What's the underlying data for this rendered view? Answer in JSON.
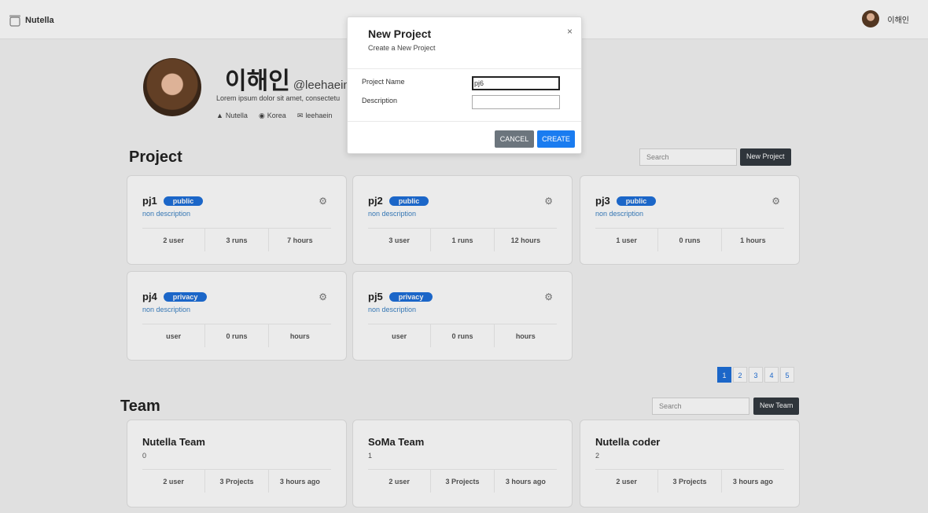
{
  "nav": {
    "brand": "Nutella",
    "user": "이해인"
  },
  "profile": {
    "name": "이해인",
    "handle": "@leehaeina",
    "bio": "Lorem ipsum dolor sit amet, consectetu",
    "org": "Nutella",
    "location": "Korea",
    "email": "leehaein"
  },
  "projects": {
    "title": "Project",
    "search_placeholder": "Search",
    "new_label": "New Project",
    "items": [
      {
        "name": "pj1",
        "badge": "public",
        "desc": "non description",
        "users": "2 user",
        "runs": "3 runs",
        "hours": "7 hours"
      },
      {
        "name": "pj2",
        "badge": "public",
        "desc": "non description",
        "users": "3 user",
        "runs": "1 runs",
        "hours": "12 hours"
      },
      {
        "name": "pj3",
        "badge": "public",
        "desc": "non description",
        "users": "1 user",
        "runs": "0 runs",
        "hours": "1 hours"
      },
      {
        "name": "pj4",
        "badge": "privacy",
        "desc": "non description",
        "users": "user",
        "runs": "0 runs",
        "hours": "hours"
      },
      {
        "name": "pj5",
        "badge": "privacy",
        "desc": "non description",
        "users": "user",
        "runs": "0 runs",
        "hours": "hours"
      }
    ],
    "pages": [
      "1",
      "2",
      "3",
      "4",
      "5"
    ]
  },
  "teams": {
    "title": "Team",
    "search_placeholder": "Search",
    "new_label": "New Team",
    "items": [
      {
        "name": "Nutella Team",
        "num": "0",
        "users": "2 user",
        "projects": "3 Projects",
        "time": "3 hours ago"
      },
      {
        "name": "SoMa Team",
        "num": "1",
        "users": "2 user",
        "projects": "3 Projects",
        "time": "3 hours ago"
      },
      {
        "name": "Nutella coder",
        "num": "2",
        "users": "2 user",
        "projects": "3 Projects",
        "time": "3 hours ago"
      }
    ]
  },
  "modal": {
    "title": "New Project",
    "subtitle": "Create a New Project",
    "close": "×",
    "name_label": "Project Name",
    "name_value": "pj6",
    "desc_label": "Description",
    "desc_value": "",
    "cancel": "CANCEL",
    "create": "CREATE"
  }
}
